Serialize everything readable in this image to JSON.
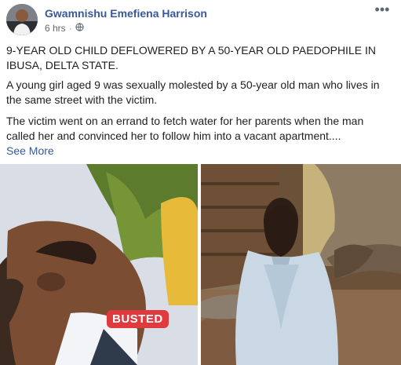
{
  "post": {
    "author": "Gwamnishu Emefiena Harrison",
    "timestamp": "6 hrs",
    "separator": "·",
    "more_icon": "ellipsis-icon",
    "privacy_icon": "globe-icon",
    "paragraphs": [
      "9-YEAR OLD CHILD DEFLOWERED BY A 50-YEAR OLD PAEDOPHILE IN IBUSA, DELTA STATE.",
      "A young girl aged 9 was sexually molested by a 50-year old man who lives in the same street with the victim.",
      "The victim went on an errand to fetch water for her parents when the man called her and convinced her to follow him into a vacant apartment...."
    ],
    "see_more": "See More",
    "photos": {
      "left_badge": "BUSTED"
    }
  }
}
